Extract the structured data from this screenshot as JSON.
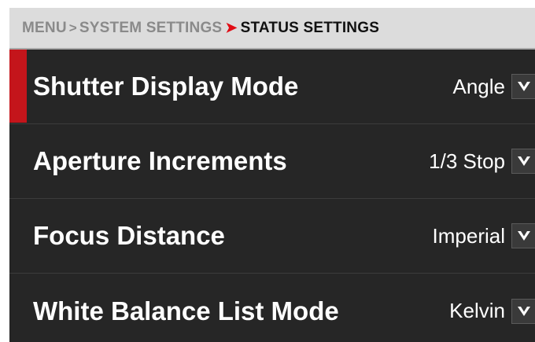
{
  "breadcrumb": {
    "items": [
      "MENU",
      "SYSTEM SETTINGS"
    ],
    "separator": ">",
    "current": "STATUS SETTINGS"
  },
  "settings": [
    {
      "label": "Shutter Display Mode",
      "value": "Angle",
      "selected": true
    },
    {
      "label": "Aperture Increments",
      "value": "1/3 Stop",
      "selected": false
    },
    {
      "label": "Focus Distance",
      "value": "Imperial",
      "selected": false
    },
    {
      "label": "White Balance List Mode",
      "value": "Kelvin",
      "selected": false
    }
  ],
  "icons": {
    "dropdown": "chevron-down-icon"
  },
  "colors": {
    "background": "#262626",
    "breadcrumb_bg": "#dcdcdc",
    "accent": "#c4151b",
    "separator_active": "#e10c14"
  }
}
